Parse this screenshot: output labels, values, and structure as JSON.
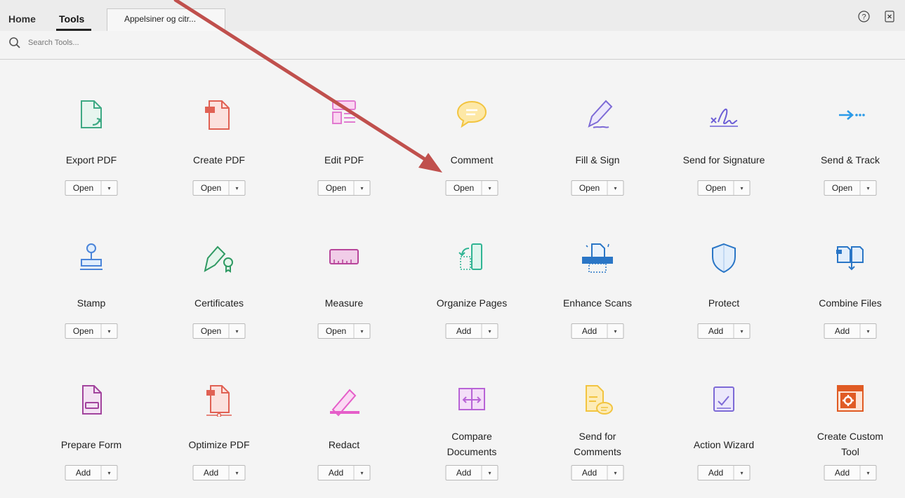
{
  "app": {
    "tabs": {
      "home": "Home",
      "tools": "Tools"
    },
    "document_tab": "Appelsiner og citr...",
    "search_placeholder": "Search Tools..."
  },
  "tools": [
    {
      "name": "Export PDF",
      "button": "Open",
      "icon": "export-pdf"
    },
    {
      "name": "Create PDF",
      "button": "Open",
      "icon": "create-pdf"
    },
    {
      "name": "Edit PDF",
      "button": "Open",
      "icon": "edit-pdf"
    },
    {
      "name": "Comment",
      "button": "Open",
      "icon": "comment"
    },
    {
      "name": "Fill & Sign",
      "button": "Open",
      "icon": "fill-sign"
    },
    {
      "name": "Send for Signature",
      "button": "Open",
      "icon": "send-for-signature"
    },
    {
      "name": "Send & Track",
      "button": "Open",
      "icon": "send-track"
    },
    {
      "name": "Stamp",
      "button": "Open",
      "icon": "stamp"
    },
    {
      "name": "Certificates",
      "button": "Open",
      "icon": "certificates"
    },
    {
      "name": "Measure",
      "button": "Open",
      "icon": "measure"
    },
    {
      "name": "Organize Pages",
      "button": "Add",
      "icon": "organize-pages"
    },
    {
      "name": "Enhance Scans",
      "button": "Add",
      "icon": "enhance-scans"
    },
    {
      "name": "Protect",
      "button": "Add",
      "icon": "protect"
    },
    {
      "name": "Combine Files",
      "button": "Add",
      "icon": "combine-files"
    },
    {
      "name": "Prepare Form",
      "button": "Add",
      "icon": "prepare-form"
    },
    {
      "name": "Optimize PDF",
      "button": "Add",
      "icon": "optimize-pdf"
    },
    {
      "name": "Redact",
      "button": "Add",
      "icon": "redact"
    },
    {
      "name": "Compare Documents",
      "button": "Add",
      "icon": "compare-documents"
    },
    {
      "name": "Send for Comments",
      "button": "Add",
      "icon": "send-for-comments"
    },
    {
      "name": "Action Wizard",
      "button": "Add",
      "icon": "action-wizard"
    },
    {
      "name": "Create Custom Tool",
      "button": "Add",
      "icon": "create-custom-tool"
    }
  ],
  "colors": {
    "annotation_arrow": "#c0504d"
  }
}
